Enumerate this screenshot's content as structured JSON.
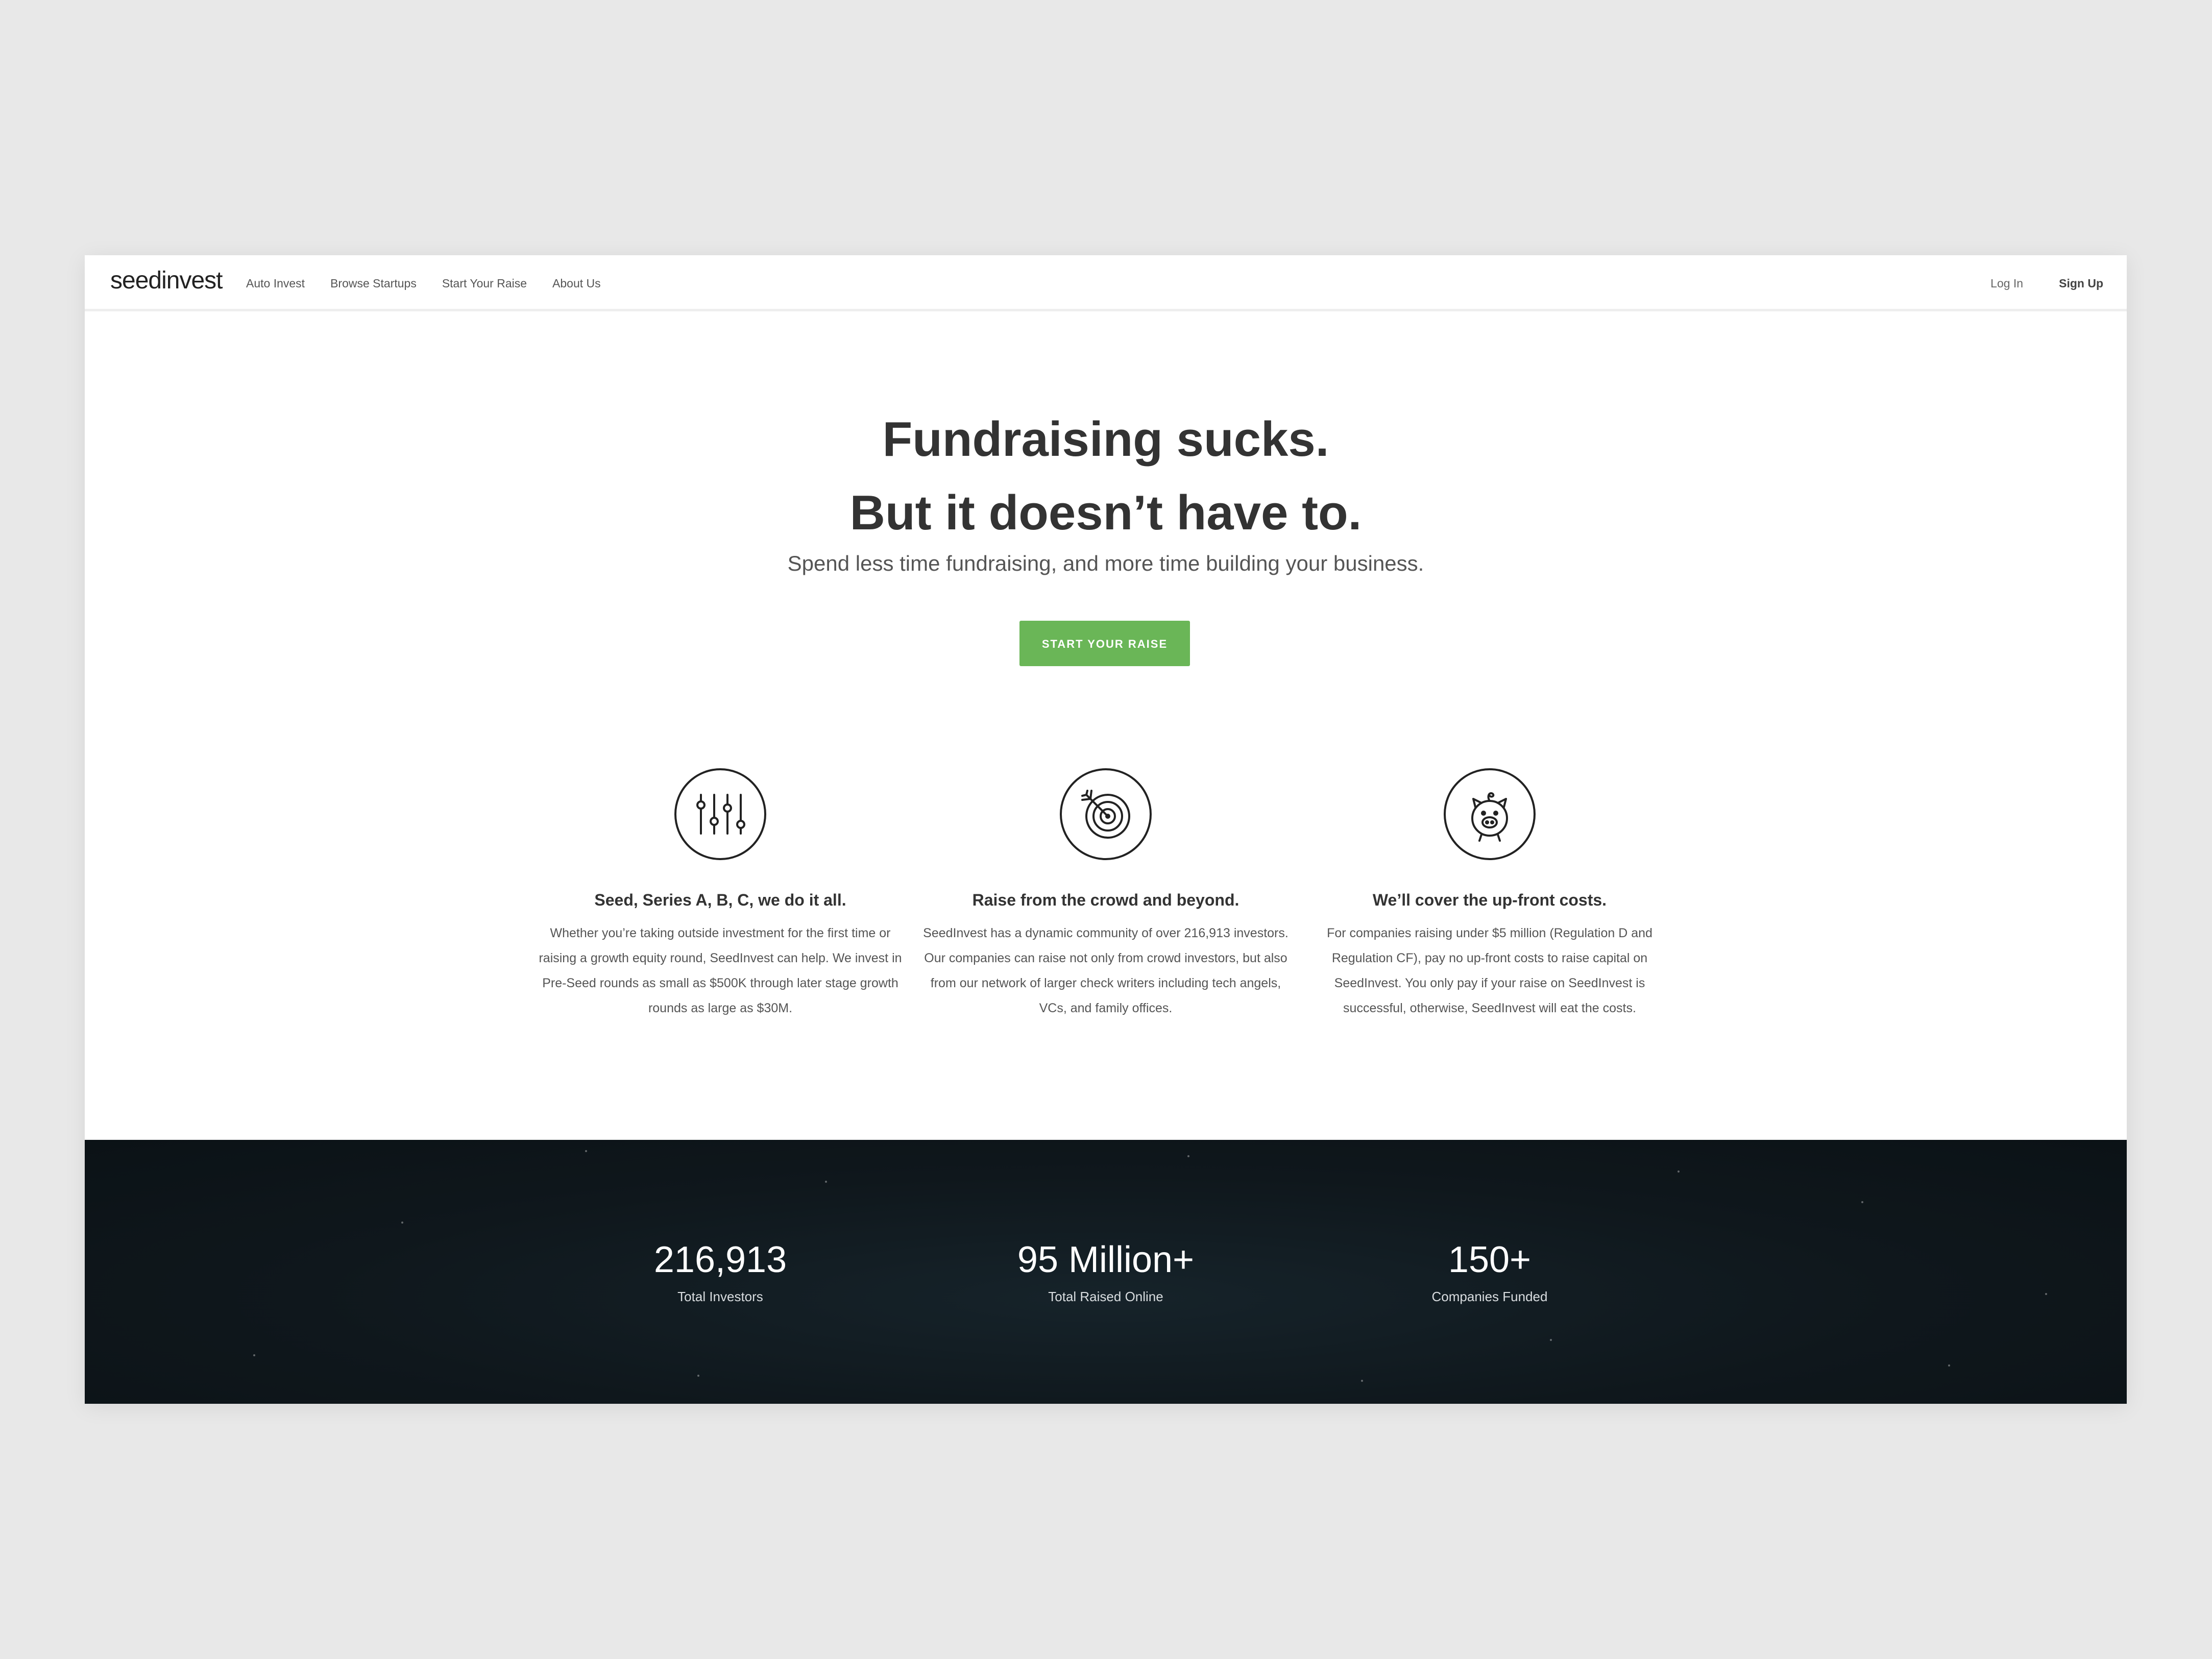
{
  "nav": {
    "logo": "seedinvest",
    "links": [
      "Auto Invest",
      "Browse Startups",
      "Start Your Raise",
      "About Us"
    ],
    "login": "Log In",
    "signup": "Sign Up"
  },
  "hero": {
    "headline_1": "Fundraising sucks.",
    "headline_2": "But it doesn’t have to.",
    "subhead": "Spend less time fundraising, and more time building your business.",
    "cta": "START YOUR RAISE",
    "cta_color": "#6ab657"
  },
  "features": [
    {
      "icon": "sliders-icon",
      "title": "Seed, Series A, B, C, we do it all.",
      "text": "Whether you’re taking outside investment for the first time or raising a growth equity round, SeedInvest can help. We invest in Pre-Seed rounds as small as $500K through later stage growth rounds as large as $30M."
    },
    {
      "icon": "target-icon",
      "title": "Raise from the crowd and beyond.",
      "text": "SeedInvest has a dynamic community of over 216,913 investors. Our companies can raise not only from crowd investors, but also from our network of larger check writers including tech angels, VCs, and family offices."
    },
    {
      "icon": "piggy-bank-icon",
      "title": "We’ll cover the up-front costs.",
      "text": "For companies raising under $5 million (Regulation D and Regulation CF), pay no up-front costs to raise capital on SeedInvest. You only pay if your raise on SeedInvest is successful, otherwise, SeedInvest will eat the costs."
    }
  ],
  "stats": [
    {
      "value": "216,913",
      "label": "Total Investors"
    },
    {
      "value": "95 Million+",
      "label": "Total Raised Online"
    },
    {
      "value": "150+",
      "label": "Companies Funded"
    }
  ]
}
